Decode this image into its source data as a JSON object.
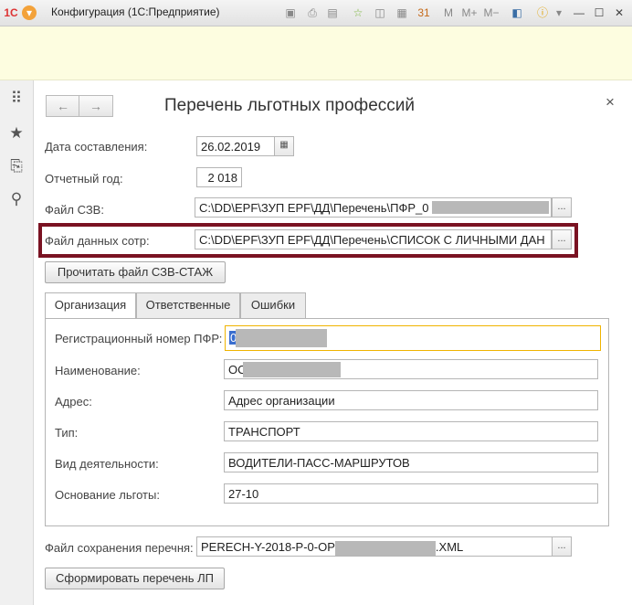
{
  "window": {
    "title": "Конфигурация  (1С:Предприятие)"
  },
  "toolbar_icons": [
    "1c-logo-icon",
    "menu-icon",
    "save-icon",
    "print-icon",
    "preview-icon",
    "favorite-icon",
    "calculator-icon",
    "calendar-icon",
    "memory-m-icon",
    "memory-plus-icon",
    "memory-minus-icon",
    "panel-icon",
    "info-icon",
    "minimize-icon",
    "maximize-icon",
    "close-icon"
  ],
  "memory": {
    "m": "M",
    "mplus": "M+",
    "mminus": "M−"
  },
  "form": {
    "title": "Перечень льготных профессий",
    "nav_back": "←",
    "nav_forward": "→",
    "close": "×",
    "fields": {
      "date_label": "Дата составления:",
      "date_value": "26.02.2019",
      "year_label": "Отчетный год:",
      "year_value": "2 018",
      "szv_label": "Файл СЗВ:",
      "szv_value": "C:\\DD\\ЕРF\\ЗУП ЕРF\\ДД\\Перечень\\ПФР_0",
      "staff_label": "Файл данных сотр:",
      "staff_value": "C:\\DD\\ЕРF\\ЗУП ЕРF\\ДД\\Перечень\\СПИСОК С ЛИЧНЫМИ ДАН",
      "pick": "..."
    },
    "read_button": "Прочитать файл СЗВ-СТАЖ",
    "tabs": [
      "Организация",
      "Ответственные",
      "Ошибки"
    ],
    "org": {
      "reg_label": "Регистрационный номер ПФР:",
      "reg_value": "0",
      "name_label": "Наименование:",
      "name_value": "ОС",
      "address_label": "Адрес:",
      "address_value": "Адрес организации",
      "type_label": "Тип:",
      "type_value": "ТРАНСПОРТ",
      "activity_label": "Вид деятельности:",
      "activity_value": "ВОДИТЕЛИ-ПАСС-МАРШРУТОВ",
      "basis_label": "Основание льготы:",
      "basis_value": "27-10"
    },
    "save_label": "Файл сохранения перечня:",
    "save_value_prefix": "PERECH-Y-2018-P-0-ОР",
    "save_value_suffix": ".XML",
    "generate_button": "Сформировать перечень ЛП"
  },
  "colors": {
    "highlight": "#7a1222",
    "focus": "#f0b400",
    "info_band": "#fdfde0"
  }
}
